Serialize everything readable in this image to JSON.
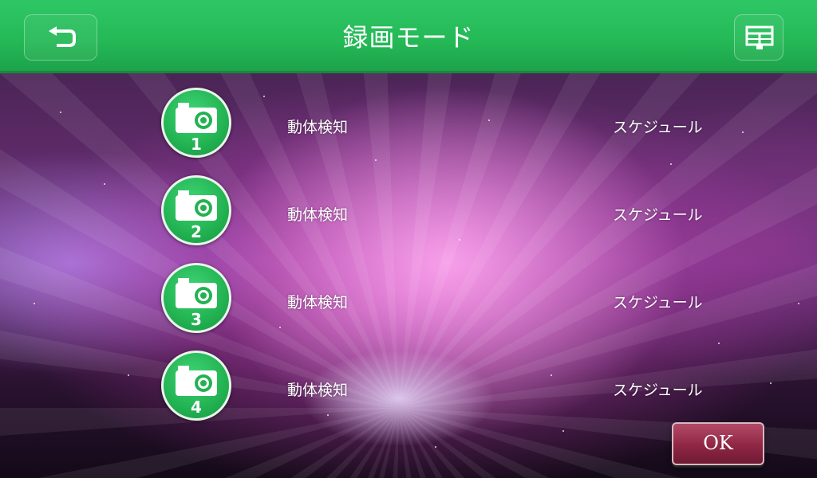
{
  "header": {
    "title": "録画モード",
    "back_icon": "back-arrow-icon",
    "menu_icon": "display-menu-icon"
  },
  "cameras": [
    {
      "number": "1",
      "mode": "動体検知",
      "schedule": "スケジュール"
    },
    {
      "number": "2",
      "mode": "動体検知",
      "schedule": "スケジュール"
    },
    {
      "number": "3",
      "mode": "動体検知",
      "schedule": "スケジュール"
    },
    {
      "number": "4",
      "mode": "動体検知",
      "schedule": "スケジュール"
    }
  ],
  "footer": {
    "ok_label": "OK"
  },
  "colors": {
    "header_green": "#24b856",
    "ok_maroon": "#8f2744"
  }
}
